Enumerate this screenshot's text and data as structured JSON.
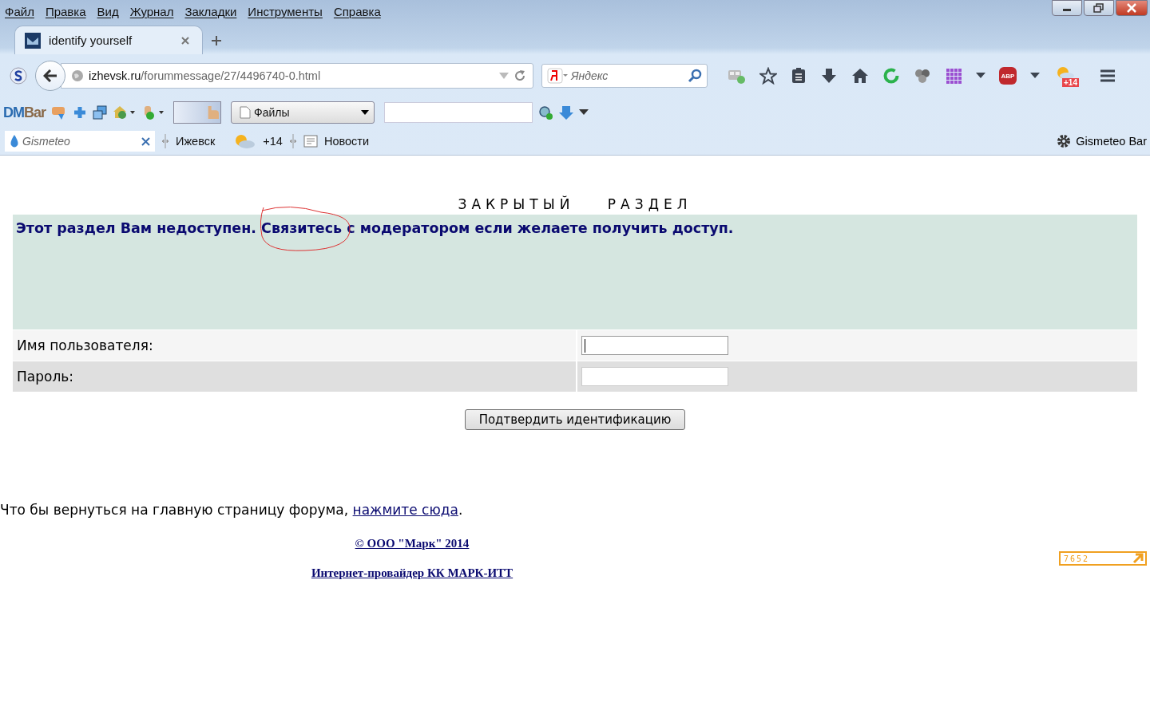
{
  "menu": [
    "Файл",
    "Правка",
    "Вид",
    "Журнал",
    "Закладки",
    "Инструменты",
    "Справка"
  ],
  "tabs": [
    {
      "title": "identify yourself",
      "selected": true
    }
  ],
  "address": {
    "host": "izhevsk.ru",
    "path": "/forummessage/27/4496740-0.html"
  },
  "search": {
    "placeholder": "Яндекс"
  },
  "toolbar_badges": {
    "abp": "ABP",
    "weather": "+14"
  },
  "dmbar": {
    "logo_part_1": "DM",
    "logo_part_2": "Bar",
    "files_dropdown": "Файлы"
  },
  "gismeteo": {
    "placeholder": "Gismeteo",
    "city": "Ижевск",
    "temperature": "+14",
    "news": "Новости",
    "bar_button": "Gismeteo Bar"
  },
  "heading": "ЗАКРЫТЫЙ РАЗДЕЛ",
  "notice": {
    "before": "Этот раздел Вам недоступен. ",
    "circled": "Связитесь",
    "after": " с модератором если желаете получить доступ."
  },
  "fields": [
    {
      "label": "Имя пользователя:",
      "focused": true
    },
    {
      "label": "Пароль:",
      "focused": false
    }
  ],
  "submit": "Подтвердить идентификацию",
  "return_line": {
    "text": "Что бы вернуться на главную страницу форума, ",
    "link": "нажмите сюда",
    "end": "."
  },
  "footer_links": [
    "© ООО \"Марк\" 2014",
    "Интернет-провайдер КК МАРК-ИТТ"
  ],
  "counter": "7652"
}
